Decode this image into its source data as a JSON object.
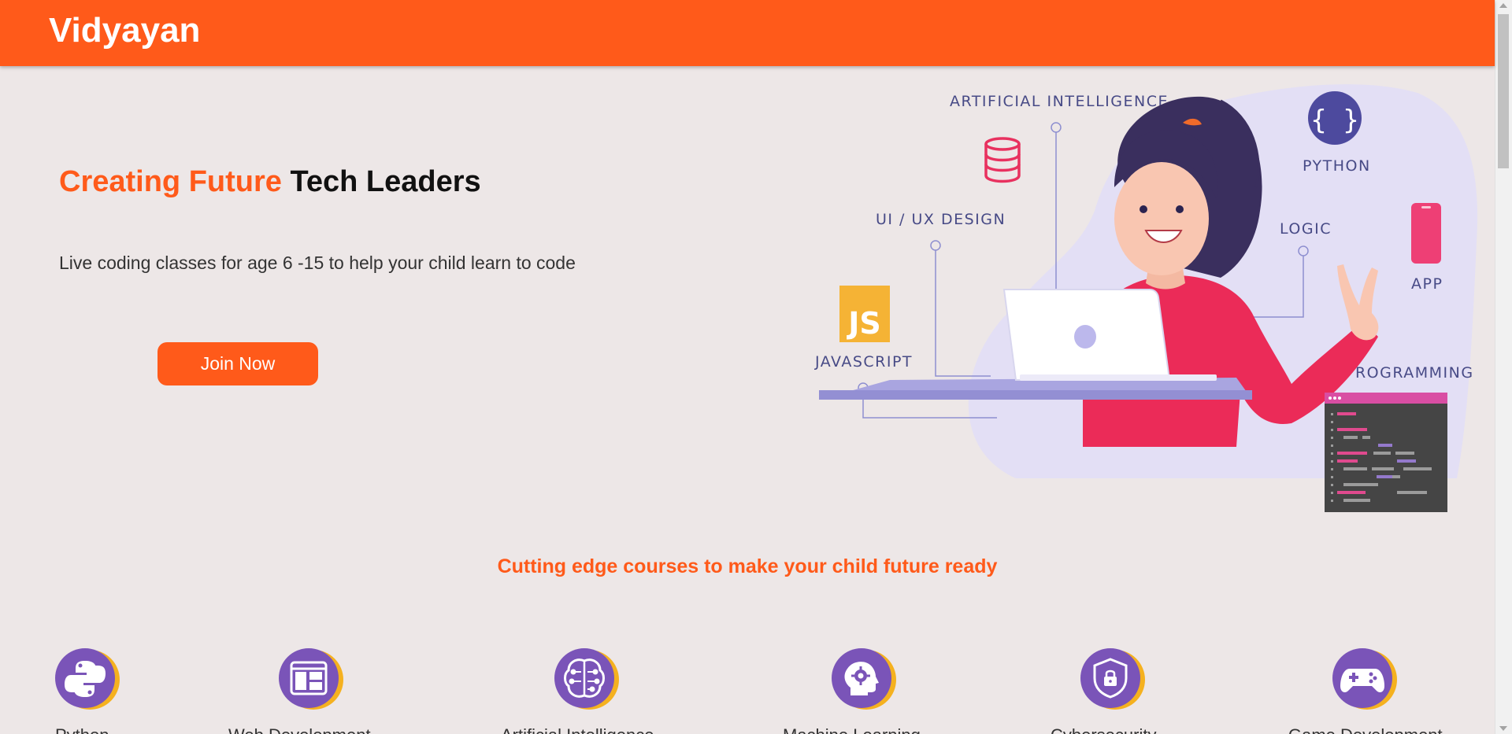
{
  "brand": "Vidyayan",
  "hero": {
    "title_accent": "Creating Future",
    "title_rest": "Tech Leaders",
    "subtitle": "Live coding classes for age 6 -15 to help your child learn to code",
    "cta_label": "Join Now"
  },
  "illustration": {
    "labels": {
      "ai": "ARTIFICIAL INTELLIGENCE",
      "python": "PYTHON",
      "uiux": "UI / UX DESIGN",
      "logic": "LOGIC",
      "app": "APP",
      "javascript": "JAVASCRIPT",
      "programming": "PROGRAMMING",
      "js_badge": "JS",
      "braces": "{ }"
    }
  },
  "courses": {
    "heading": "Cutting edge courses to make your child future ready",
    "items": [
      {
        "label": "Python",
        "icon": "python-icon"
      },
      {
        "label": "Web Development",
        "icon": "web-layout-icon"
      },
      {
        "label": "Artificial Intelligence",
        "icon": "brain-circuit-icon"
      },
      {
        "label": "Machine Learning",
        "icon": "head-gear-icon"
      },
      {
        "label": "Cybersecurity",
        "icon": "shield-lock-icon"
      },
      {
        "label": "Game Development",
        "icon": "gamepad-icon"
      }
    ]
  },
  "colors": {
    "brand": "#ff5a1a",
    "background": "#ede7e7",
    "icon_purple": "#7a54b8",
    "icon_yellow": "#f5b11f"
  }
}
